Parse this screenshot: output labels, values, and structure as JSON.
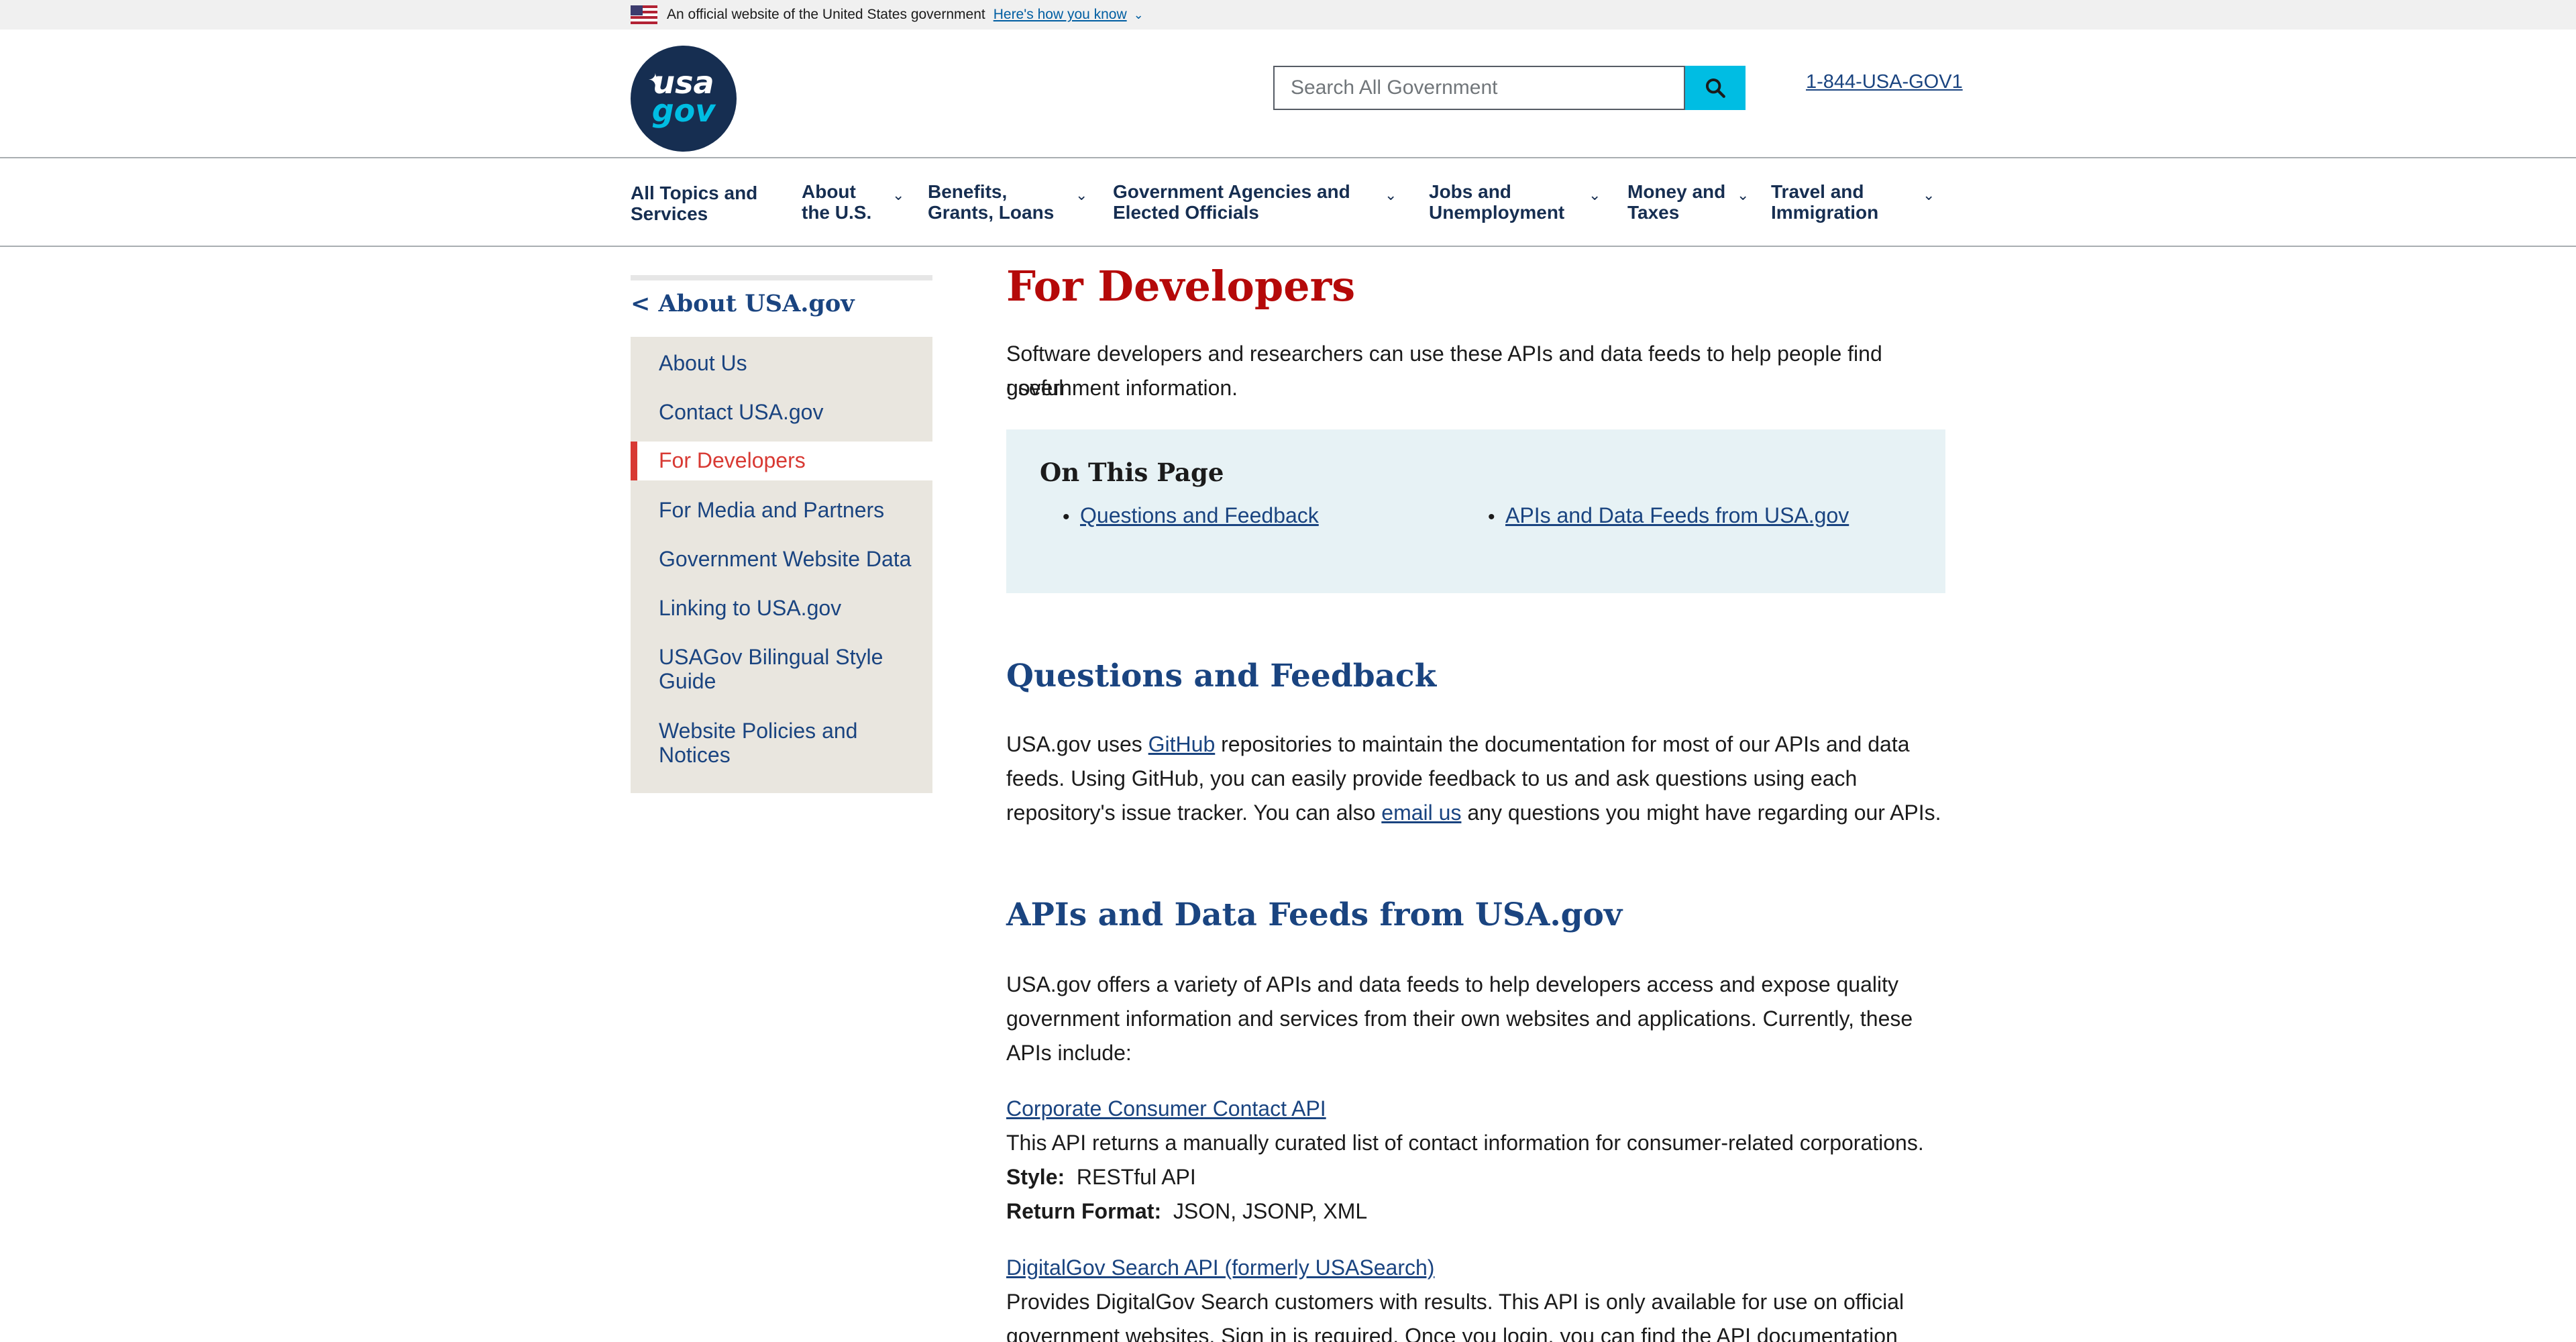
{
  "banner": {
    "official_text": "An official website of the United States government",
    "how_link": "Here's how you know"
  },
  "header": {
    "logo_usa": "usa",
    "logo_gov": "gov",
    "search_placeholder": "Search All Government",
    "phone": "1-844-USA-GOV1"
  },
  "nav": {
    "items": [
      {
        "label_1": "All Topics and",
        "label_2": "Services"
      },
      {
        "label_1": "About",
        "label_2": "the U.S."
      },
      {
        "label_1": "Benefits,",
        "label_2": "Grants, Loans"
      },
      {
        "label_1": "Government Agencies and",
        "label_2": "Elected Officials"
      },
      {
        "label_1": "Jobs and",
        "label_2": "Unemployment"
      },
      {
        "label_1": "Money and",
        "label_2": "Taxes"
      },
      {
        "label_1": "Travel and",
        "label_2": "Immigration"
      }
    ]
  },
  "sidebar": {
    "back": "< About USA.gov",
    "items": [
      {
        "label": "About Us"
      },
      {
        "label": "Contact USA.gov"
      },
      {
        "label": "For Developers"
      },
      {
        "label": "For Media and Partners"
      },
      {
        "label": "Government Website Data"
      },
      {
        "label": "Linking to USA.gov"
      },
      {
        "label_1": "USAGov Bilingual Style",
        "label_2": "Guide"
      },
      {
        "label_1": "Website Policies and",
        "label_2": "Notices"
      }
    ]
  },
  "main": {
    "title": "For Developers",
    "intro_1": "Software developers and researchers can use these APIs and data feeds to help people find useful",
    "intro_2": "government information.",
    "on_this_page": {
      "title": "On This Page",
      "links": [
        "Questions and Feedback",
        "APIs and Data Feeds from USA.gov"
      ]
    },
    "section1": {
      "heading": "Questions and Feedback",
      "l1_a": "USA.gov uses ",
      "l1_link": "GitHub",
      "l1_b": " repositories to maintain the documentation for most of our APIs and data",
      "l2": "feeds.  Using GitHub, you can easily provide feedback to us and ask questions using each",
      "l3_a": "repository's issue tracker.  You can also ",
      "l3_link": "email us",
      "l3_b": " any questions you might have regarding our APIs."
    },
    "section2": {
      "heading": "APIs and Data Feeds from USA.gov",
      "l1": "USA.gov offers a variety of APIs and data feeds to help developers access and expose quality",
      "l2": "government information and services from their own websites and applications.  Currently, these",
      "l3": "APIs include:",
      "api1": {
        "link": "Corporate Consumer Contact API",
        "desc": "This API returns a manually curated list of contact information for consumer-related corporations.",
        "style_label": "Style:",
        "style_value": "RESTful API",
        "format_label": "Return Format:",
        "format_value": "JSON, JSONP, XML"
      },
      "api2": {
        "link": "DigitalGov Search API (formerly USASearch)",
        "desc_1": "Provides DigitalGov Search customers with results. This API is only available for use on official",
        "desc_2": "government websites. Sign in is required.  Once you login, you can find the API documentation"
      }
    }
  }
}
